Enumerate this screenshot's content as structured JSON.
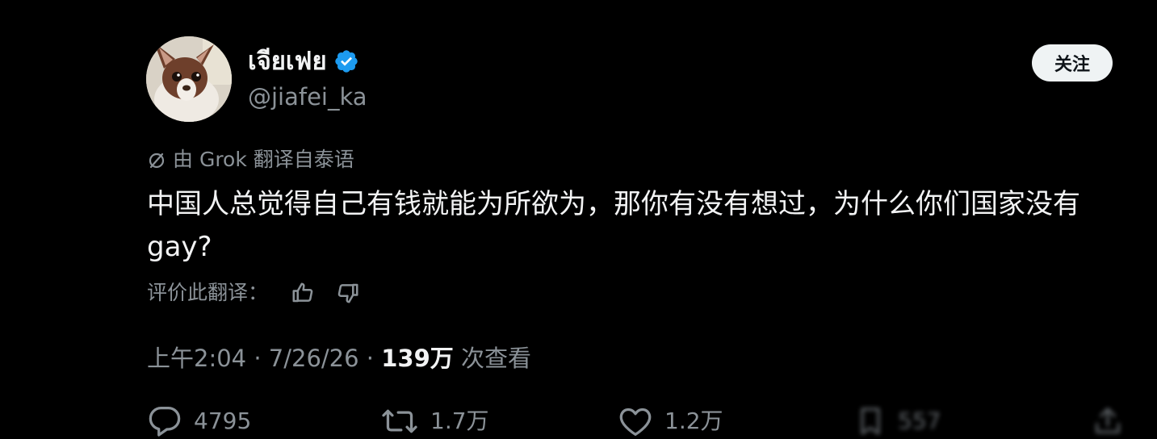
{
  "author": {
    "display_name": "เจียเฟย",
    "handle": "@jiafei_ka",
    "verified": true,
    "verified_color": "#1d9bf0"
  },
  "follow_button": {
    "label": "关注"
  },
  "translation": {
    "note": "由 Grok 翻译自泰语",
    "rate_label": "评价此翻译："
  },
  "tweet": {
    "text": "中国人总觉得自己有钱就能为所欲为，那你有没有想过，为什么你们国家没有gay?"
  },
  "meta": {
    "time": "上午2:04",
    "date": "7/26/26",
    "views_count": "139万",
    "views_label": "次查看"
  },
  "actions": {
    "replies": "4795",
    "retweets": "1.7万",
    "likes": "1.2万",
    "bookmarks": "557"
  },
  "colors": {
    "background": "#000000",
    "primary_text": "#f2f3f4",
    "secondary_text": "#8b9298",
    "button_bg": "#eff3f4"
  }
}
